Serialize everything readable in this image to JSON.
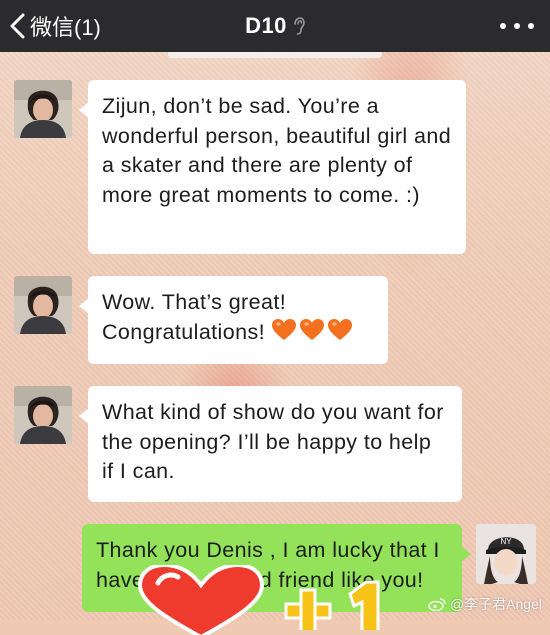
{
  "header": {
    "back_label": "微信(1)",
    "title": "D10"
  },
  "messages": [
    {
      "side": "left",
      "text": "Zijun, don’t be sad. You’re a wonderful person, beautiful girl and a skater and there are plenty  of more great moments to come. :)"
    },
    {
      "side": "left",
      "text": "Wow. That’s great! Congratulations!",
      "emoji": [
        "orange-heart",
        "orange-heart",
        "orange-heart"
      ]
    },
    {
      "side": "left",
      "text": "What kind of show do you want for the opening? I’ll be happy to help if I can."
    },
    {
      "side": "right",
      "text": "Thank you Denis , I am lucky that I have such a good friend like you!"
    }
  ],
  "watermark": {
    "text": "@李子君Angel"
  },
  "colors": {
    "topbar": "#2b2b2d",
    "outgoing_bubble": "#93e25a",
    "incoming_bubble": "#ffffff",
    "heart": "#f2701f"
  },
  "icons": {
    "back": "chevron-left-icon",
    "voice_mode": "ear-icon",
    "more": "more-dots-icon"
  }
}
